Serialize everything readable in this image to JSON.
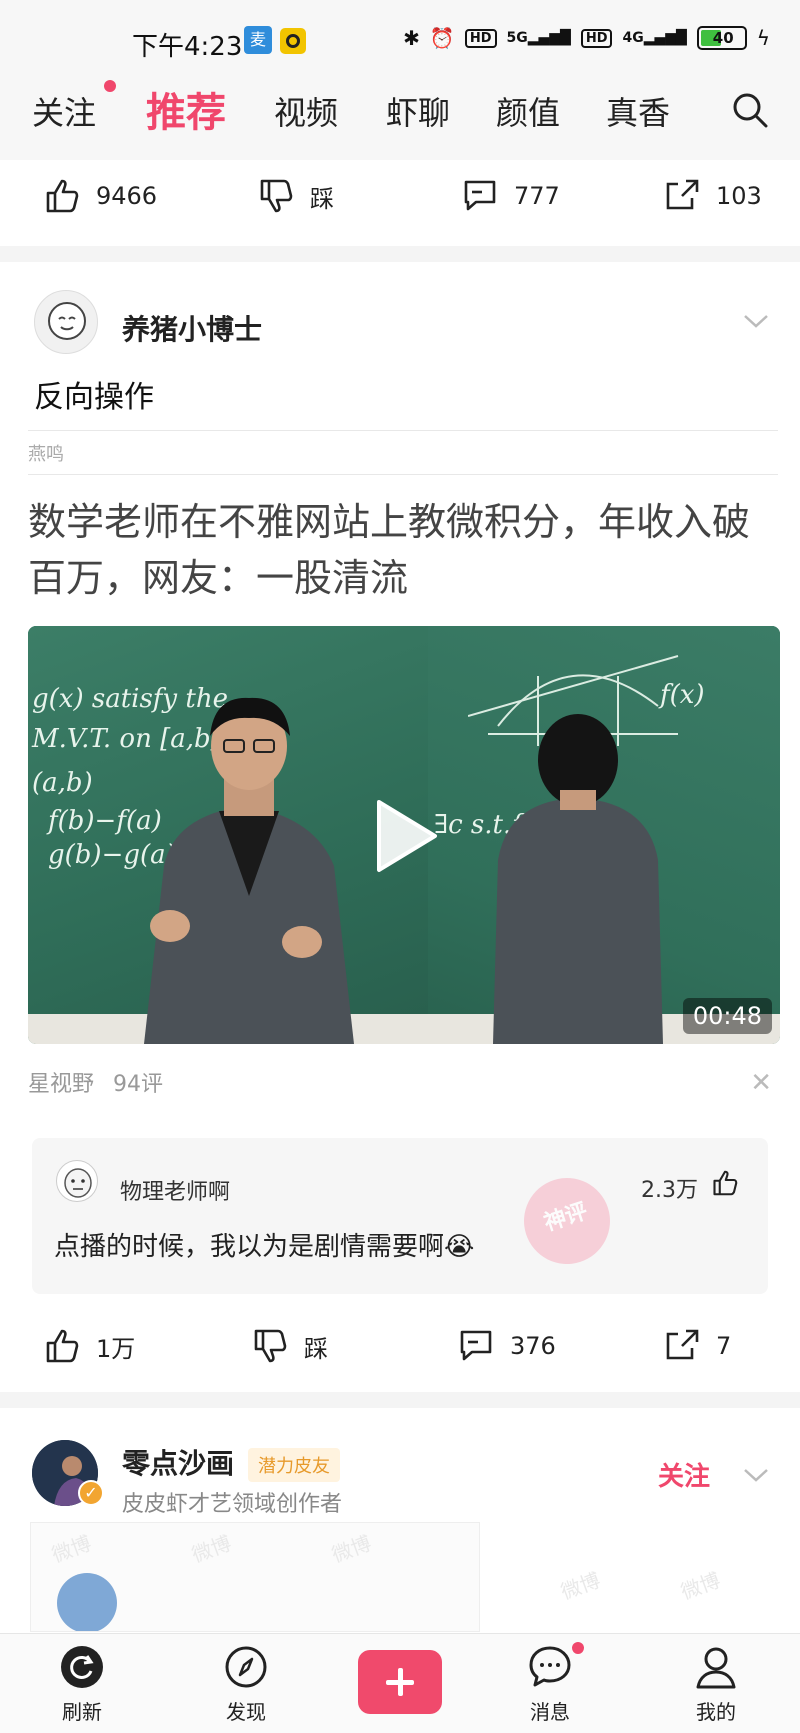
{
  "status_bar": {
    "time": "下午4:23",
    "app_icon_label": "麦",
    "network_1": "5G",
    "network_2": "4G",
    "hd_label": "HD",
    "battery": "40"
  },
  "top_nav": {
    "tabs": [
      {
        "label": "关注",
        "active": false
      },
      {
        "label": "推荐",
        "active": true
      },
      {
        "label": "视频",
        "active": false
      },
      {
        "label": "虾聊",
        "active": false
      },
      {
        "label": "颜值",
        "active": false
      },
      {
        "label": "真香",
        "active": false
      }
    ],
    "search_icon": "search-icon"
  },
  "prev_card": {
    "likes": "9466",
    "dislike_label": "踩",
    "comments": "777",
    "shares": "103"
  },
  "post": {
    "username": "养猪小博士",
    "text": "反向操作",
    "source": "燕鸣",
    "headline": "数学老师在不雅网站上教微积分，年收入破百万，网友：一股清流",
    "video_duration": "00:48",
    "channel": "星视野",
    "comment_count": "94评",
    "top_comment": {
      "username": "物理老师啊",
      "text": "点播的时候，我以为是剧情需要啊😭",
      "likes": "2.3万",
      "stamp": "神评"
    },
    "likes": "1万",
    "dislike_label": "踩",
    "comments": "376",
    "shares": "7"
  },
  "next_post": {
    "username": "零点沙画",
    "badge": "潜力皮友",
    "subtitle": "皮皮虾才艺领域创作者",
    "follow_label": "关注",
    "watermark": "微博"
  },
  "bottom_nav": {
    "items": [
      {
        "label": "刷新"
      },
      {
        "label": "发现"
      },
      {
        "label": "消息"
      },
      {
        "label": "我的"
      }
    ]
  },
  "colors": {
    "accent": "#f0476c",
    "badge_text": "#e79a2b",
    "chalkboard": "#2f6d57"
  }
}
